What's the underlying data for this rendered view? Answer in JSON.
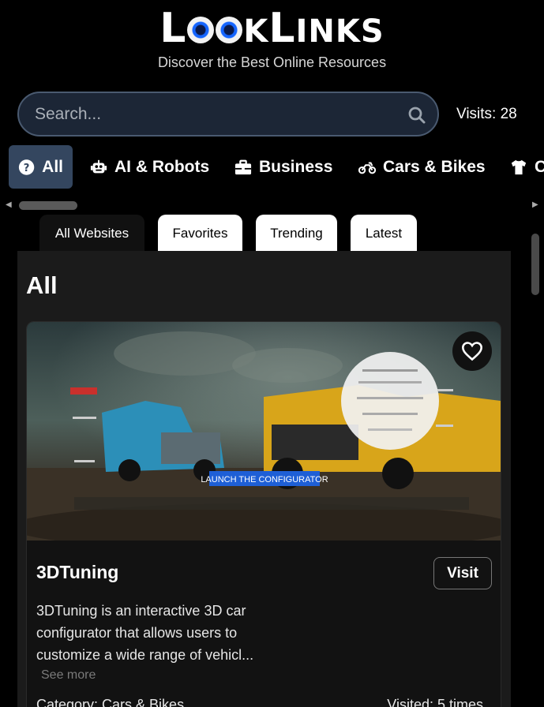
{
  "header": {
    "logo_text": "LOOKLINKS",
    "tagline": "Discover the Best Online Resources"
  },
  "search": {
    "placeholder": "Search...",
    "visits_label": "Visits: 28"
  },
  "categories": [
    {
      "label": "All",
      "icon": "question-circle-icon",
      "active": true
    },
    {
      "label": "AI & Robots",
      "icon": "robot-icon",
      "active": false
    },
    {
      "label": "Business",
      "icon": "briefcase-icon",
      "active": false
    },
    {
      "label": "Cars & Bikes",
      "icon": "motorcycle-icon",
      "active": false
    },
    {
      "label": "C",
      "icon": "tshirt-icon",
      "active": false
    }
  ],
  "tabs": [
    {
      "label": "All Websites",
      "active": true
    },
    {
      "label": "Favorites",
      "active": false
    },
    {
      "label": "Trending",
      "active": false
    },
    {
      "label": "Latest",
      "active": false
    }
  ],
  "section": {
    "title": "All"
  },
  "card": {
    "title": "3DTuning",
    "visit_label": "Visit",
    "description": "3DTuning is an interactive 3D car configurator that allows users to customize a wide range of vehicl...",
    "see_more": "See more",
    "category": "Category: Cars & Bikes",
    "visited": "Visited: 5 times",
    "image_banner": "LAUNCH THE CONFIGURATOR",
    "favorite_icon": "heart-icon"
  },
  "colors": {
    "background": "#000000",
    "active_category": "#34465f",
    "search_bg": "#1c2636",
    "card_bg": "#121212"
  }
}
